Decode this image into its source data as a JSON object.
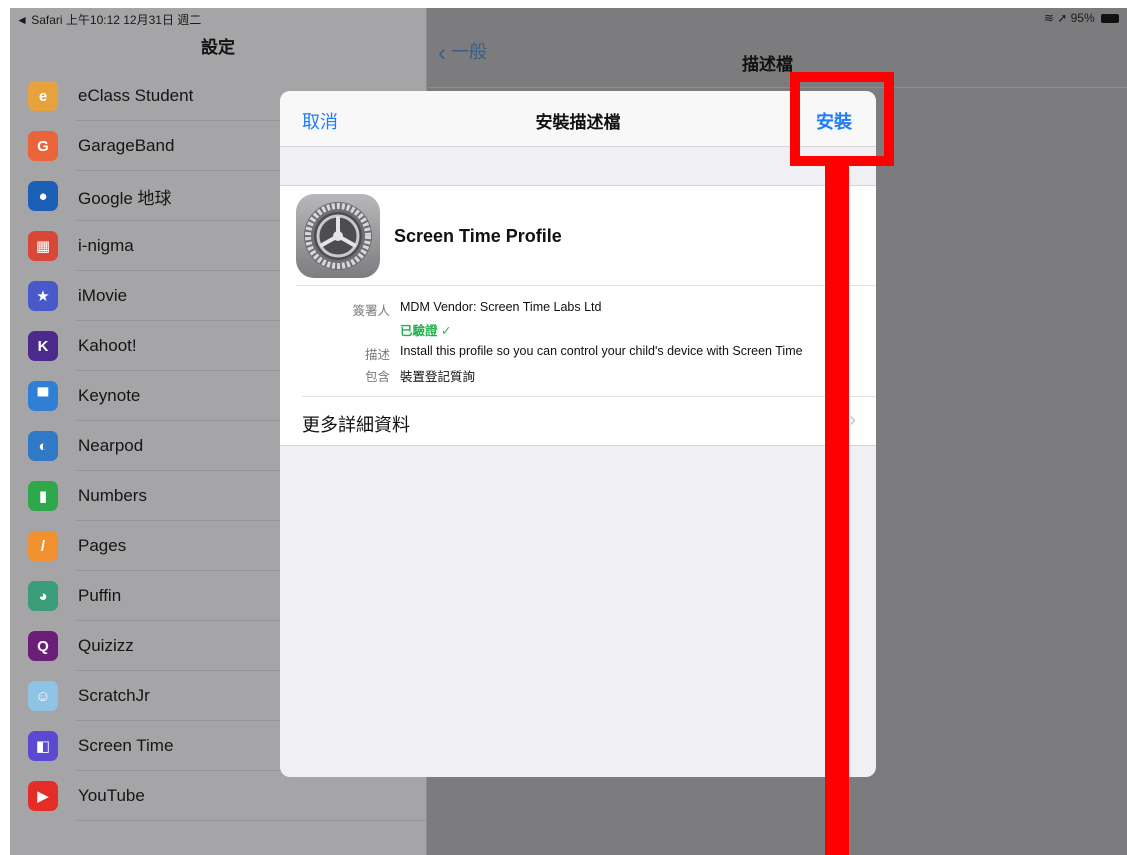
{
  "status_bar": {
    "left": "◄ Safari  上午10:12  12月31日 週二",
    "right": "95%"
  },
  "sidebar": {
    "title": "設定",
    "apps": [
      {
        "name": "eClass Student",
        "color": "#e6a23c",
        "glyph": "e"
      },
      {
        "name": "GarageBand",
        "color": "#e9643b",
        "glyph": "G"
      },
      {
        "name": "Google 地球",
        "color": "#1c5fb6",
        "glyph": "●"
      },
      {
        "name": "i-nigma",
        "color": "#d94738",
        "glyph": "▦"
      },
      {
        "name": "iMovie",
        "color": "#4a59c9",
        "glyph": "★"
      },
      {
        "name": "Kahoot!",
        "color": "#4c2a8c",
        "glyph": "K"
      },
      {
        "name": "Keynote",
        "color": "#2f7fd7",
        "glyph": "▀"
      },
      {
        "name": "Nearpod",
        "color": "#2f79c6",
        "glyph": "◐"
      },
      {
        "name": "Numbers",
        "color": "#2ea84a",
        "glyph": "▮"
      },
      {
        "name": "Pages",
        "color": "#f1902f",
        "glyph": "/"
      },
      {
        "name": "Puffin",
        "color": "#3a9c78",
        "glyph": "◕"
      },
      {
        "name": "Quizizz",
        "color": "#6a1e78",
        "glyph": "Q"
      },
      {
        "name": "ScratchJr",
        "color": "#8fc3e6",
        "glyph": "☺"
      },
      {
        "name": "Screen Time",
        "color": "#5b4ad1",
        "glyph": "◧"
      },
      {
        "name": "YouTube",
        "color": "#e52d27",
        "glyph": "▶"
      }
    ]
  },
  "detail": {
    "back_label": "一般",
    "title": "描述檔"
  },
  "modal": {
    "cancel_label": "取消",
    "title": "安裝描述檔",
    "install_label": "安裝",
    "profile_name": "Screen Time Profile",
    "signer_label": "簽署人",
    "signer_value": "MDM Vendor: Screen Time Labs Ltd",
    "verified_label": "已驗證 ✓",
    "description_label": "描述",
    "description_value": "Install this profile so you can control your child's device with Screen Time",
    "contains_label": "包含",
    "contains_value": "裝置登記質詢",
    "more_details_label": "更多詳細資料"
  }
}
